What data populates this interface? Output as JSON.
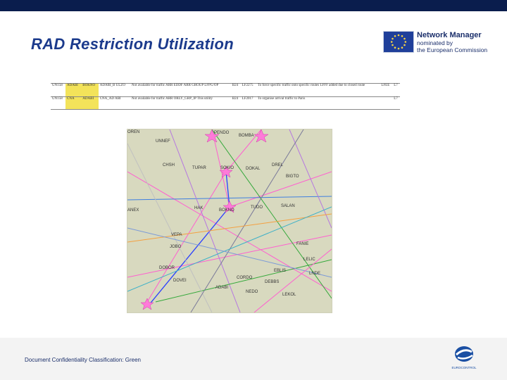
{
  "slide": {
    "title": "RAD Restriction Utilization",
    "footer": "Document Confidentiality Classification: Green"
  },
  "brand": {
    "line1": "Network Manager",
    "line2": "nominated by",
    "line3": "the European Commission",
    "ec_logo_text": "EUROCONTROL",
    "top_bar_color": "#0a1d4d",
    "title_color": "#1b3a8c"
  },
  "rad_table": {
    "rows": [
      {
        "id": "UN158",
        "points_a": "ADABI",
        "points_b": "BOKNO",
        "route": "ADABI_B ULZO",
        "condition": "Not available for traffic ARR EDDF ARR GROUP LFPG/OP",
        "level": "B24",
        "ref": "LF2275",
        "remark": "To force specific traffic onto specific routes LFFF added due to closed route",
        "unit": "LFEE",
        "code": "L7"
      },
      {
        "id": "UN158",
        "points_a": "CNA",
        "points_b": "ADABI",
        "route": "CNA_AD ABI",
        "condition": "Not available for traffic ARR ORLY_GRP_IP This utility",
        "level": "B24",
        "ref": "LF2017",
        "remark": "To organise arrival traffic to Paris",
        "unit": "",
        "code": "L7"
      }
    ]
  },
  "map_labels": [
    "PENDO",
    "BOMBA",
    "UNNEF",
    "OREN",
    "CHSH",
    "TUPAR",
    "SOKIO",
    "DOKAL",
    "DREL",
    "BIGTO",
    "ANEX",
    "SALAN",
    "HAK",
    "BOKNO",
    "TUDO",
    "VEPA",
    "JOBO",
    "FANIE",
    "LELIC",
    "DOBOR",
    "EBLIS",
    "DEBBS",
    "DOVEI",
    "CORDO",
    "ADABI",
    "LNDE",
    "LEKOL",
    "NEDO"
  ]
}
